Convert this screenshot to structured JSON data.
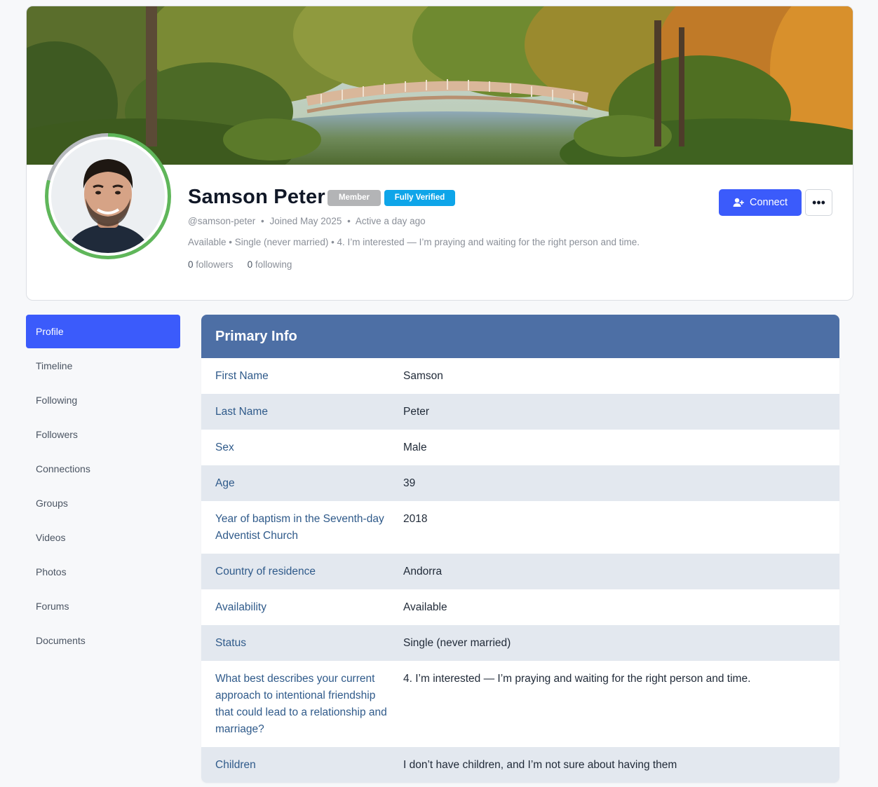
{
  "profile": {
    "name": "Samson Peter",
    "badges": {
      "member": "Member",
      "verified": "Fully Verified"
    },
    "handle": "@samson-peter",
    "joined": "Joined May 2025",
    "active": "Active a day ago",
    "about": "Available • Single (never married) • 4. I’m interested — I’m praying and waiting for the right person and time.",
    "followers_count": "0",
    "followers_label": "followers",
    "following_count": "0",
    "following_label": "following",
    "separator": "•"
  },
  "actions": {
    "connect_label": "Connect",
    "connect_icon": "add-user-icon",
    "more_icon": "ellipsis-icon",
    "more_glyph": "•••"
  },
  "colors": {
    "accent": "#3b5bfb",
    "panel_header": "#4d6fa5",
    "verified": "#0ea5e9",
    "member": "#b3b4b6",
    "avatar_ring": "#5fb65a"
  },
  "sidebar": {
    "items": [
      {
        "label": "Profile",
        "active": true
      },
      {
        "label": "Timeline"
      },
      {
        "label": "Following"
      },
      {
        "label": "Followers"
      },
      {
        "label": "Connections"
      },
      {
        "label": "Groups"
      },
      {
        "label": "Videos"
      },
      {
        "label": "Photos"
      },
      {
        "label": "Forums"
      },
      {
        "label": "Documents"
      }
    ]
  },
  "primary_info": {
    "title": "Primary Info",
    "rows": [
      {
        "label": "First Name",
        "value": "Samson"
      },
      {
        "label": "Last Name",
        "value": "Peter"
      },
      {
        "label": "Sex",
        "value": "Male"
      },
      {
        "label": "Age",
        "value": "39"
      },
      {
        "label": "Year of baptism in the Seventh-day Adventist Church",
        "value": "2018"
      },
      {
        "label": "Country of residence",
        "value": "Andorra"
      },
      {
        "label": "Availability",
        "value": "Available"
      },
      {
        "label": "Status",
        "value": "Single (never married)"
      },
      {
        "label": "What best describes your current approach to intentional friendship that could lead to a relationship and marriage?",
        "value": "4. I’m interested — I’m praying and waiting for the right person and time."
      },
      {
        "label": "Children",
        "value": "I don’t have children, and I’m not sure about having them"
      }
    ]
  }
}
